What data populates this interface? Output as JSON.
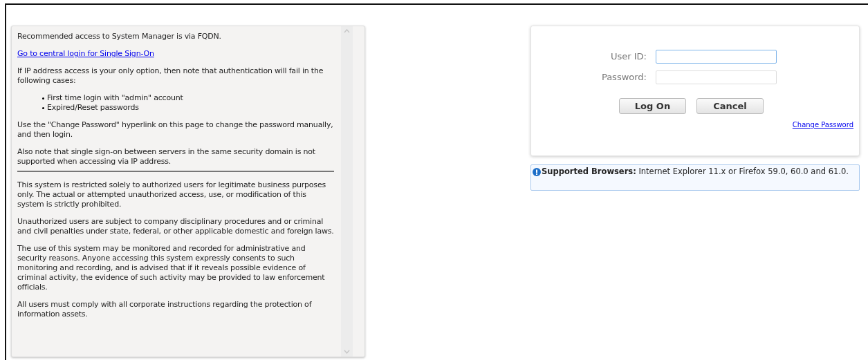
{
  "notice": {
    "blocks": [
      {
        "kind": "text",
        "text": "Recommended access to System Manager is via FQDN."
      },
      {
        "kind": "link",
        "text": "Go to central login for Single Sign-On"
      },
      {
        "kind": "text",
        "text": "If IP address access is your only option, then note that authentication will fail in the following cases:"
      },
      {
        "kind": "list",
        "items": [
          "First time login with \"admin\" account",
          "Expired/Reset passwords"
        ]
      },
      {
        "kind": "text",
        "text": "Use the \"Change Password\" hyperlink on this page to change the password manually, and then login."
      },
      {
        "kind": "text",
        "text": "Also note that single sign-on between servers in the same security domain is not supported when accessing via IP address."
      },
      {
        "kind": "divider"
      },
      {
        "kind": "text",
        "text": "This system is restricted solely to authorized users for legitimate business purposes only. The actual or attempted unauthorized access, use, or modification of this system is strictly prohibited."
      },
      {
        "kind": "text",
        "text": "Unauthorized users are subject to company disciplinary procedures and or criminal and civil penalties under state, federal, or other applicable domestic and foreign laws."
      },
      {
        "kind": "text",
        "text": "The use of this system may be monitored and recorded for administrative and security reasons. Anyone accessing this system expressly consents to such monitoring and recording, and is advised that if it reveals possible evidence of criminal activity, the evidence of such activity may be provided to law enforcement officials."
      },
      {
        "kind": "text",
        "text": "All users must comply with all corporate instructions regarding the protection of information assets."
      }
    ]
  },
  "login": {
    "fields": [
      {
        "label": "User ID:",
        "focused": true
      },
      {
        "label": "Password:",
        "focused": false
      }
    ],
    "buttons": [
      "Log On",
      "Cancel"
    ],
    "change_password": "Change Password"
  },
  "info": {
    "text": "**Supported Browsers:** Internet Explorer 11.x or Firefox 59.0, 60.0 and 61.0."
  }
}
